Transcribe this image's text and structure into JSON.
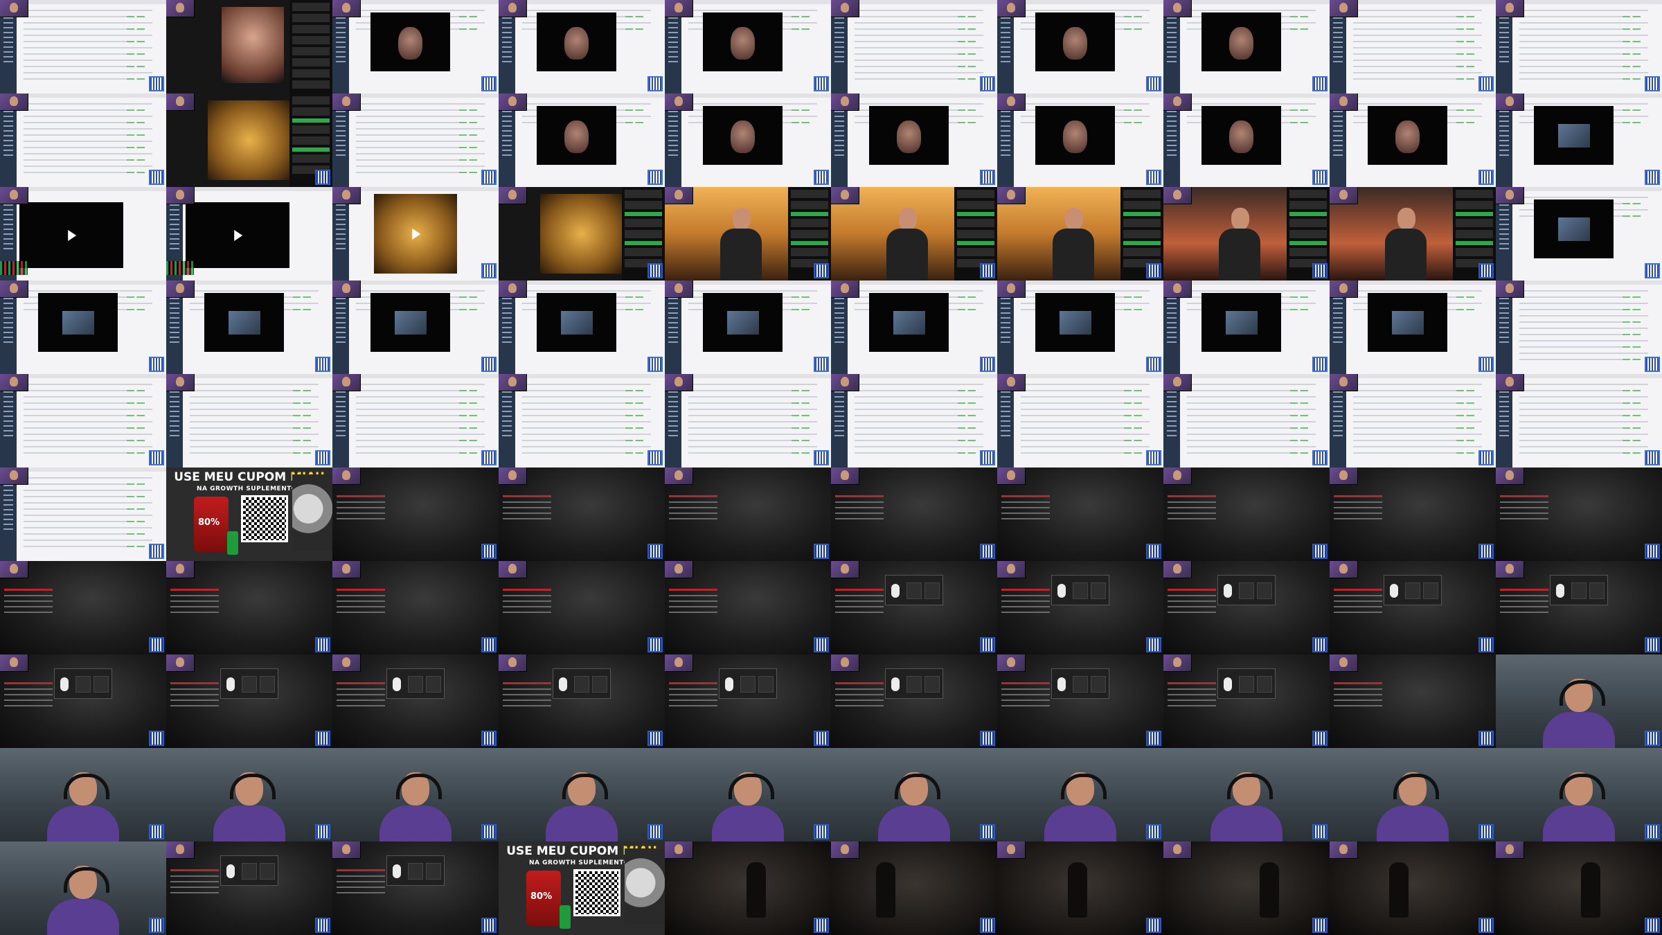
{
  "window": {
    "title": ""
  },
  "ad": {
    "title_part1": "USE MEU CUPOM ",
    "title_highlight": "MIAU",
    "subtitle": "NA GROWTH SUPLEMENTOS",
    "badge": "80%"
  },
  "colors": {
    "browser_bg": "#f4f4f6",
    "sidebar": "#27364a",
    "accent_green": "#6ec27c",
    "accent_red": "#b6262a",
    "shirt_purple": "#5a3e91",
    "ad_highlight": "#f2d43a",
    "qr_blue": "#2b62d9"
  },
  "icons": [
    "play-icon",
    "qr-code-icon",
    "mouse-icon",
    "webcam-icon"
  ],
  "grid": {
    "rows": 10,
    "cols": 10,
    "tiles": [
      [
        "list",
        "video-dark",
        "post-portrait",
        "post-portrait",
        "post-portrait",
        "list",
        "post-face",
        "post-face",
        "list",
        "list"
      ],
      [
        "list",
        "gold-video",
        "list",
        "post-face",
        "post-face",
        "post-face",
        "post-face",
        "post-face",
        "post-face",
        "post-black"
      ],
      [
        "short",
        "short",
        "gold-short",
        "gold-video",
        "sunset",
        "sunset",
        "sunset",
        "studio",
        "studio",
        "post-black"
      ],
      [
        "post-black",
        "post-black",
        "post-black",
        "post-black",
        "post-black",
        "post-black",
        "post-black",
        "post-black",
        "post-black",
        "list"
      ],
      [
        "list",
        "list",
        "list",
        "list",
        "list",
        "list",
        "list",
        "list",
        "list",
        "list"
      ],
      [
        "list",
        "ad",
        "room",
        "room",
        "room",
        "room",
        "room",
        "room",
        "room",
        "room"
      ],
      [
        "room",
        "room",
        "room",
        "room",
        "room",
        "overlay",
        "overlay",
        "overlay",
        "overlay",
        "overlay"
      ],
      [
        "overlay",
        "overlay",
        "overlay",
        "overlay",
        "overlay",
        "overlay",
        "overlay",
        "overlay",
        "room",
        "webcam"
      ],
      [
        "webcam",
        "webcam",
        "webcam",
        "webcam",
        "webcam",
        "webcam",
        "webcam",
        "webcam",
        "webcam",
        "webcam"
      ],
      [
        "webcam",
        "overlay",
        "overlay",
        "ad",
        "game",
        "game",
        "game",
        "game",
        "game",
        "game"
      ]
    ]
  }
}
